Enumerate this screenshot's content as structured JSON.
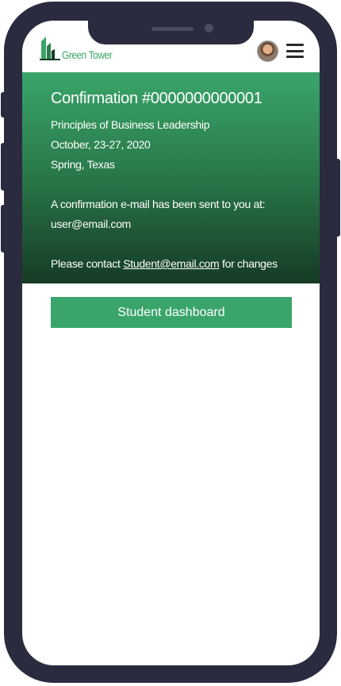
{
  "brand": {
    "name": "Green Tower",
    "color": "#3aa56a"
  },
  "header": {
    "avatar_icon": "user-avatar",
    "menu_icon": "hamburger-menu-icon"
  },
  "confirmation": {
    "title": "Confirmation #0000000000001",
    "course": "Principles of Business Leadership",
    "dates": "October, 23-27, 2020",
    "location": "Spring, Texas",
    "email_notice": "A confirmation e-mail has been sent to you at:",
    "user_email": "user@email.com",
    "contact_prefix": "Please contact ",
    "contact_email": "Student@email.com",
    "contact_suffix": " for changes"
  },
  "actions": {
    "dashboard_label": "Student dashboard"
  }
}
